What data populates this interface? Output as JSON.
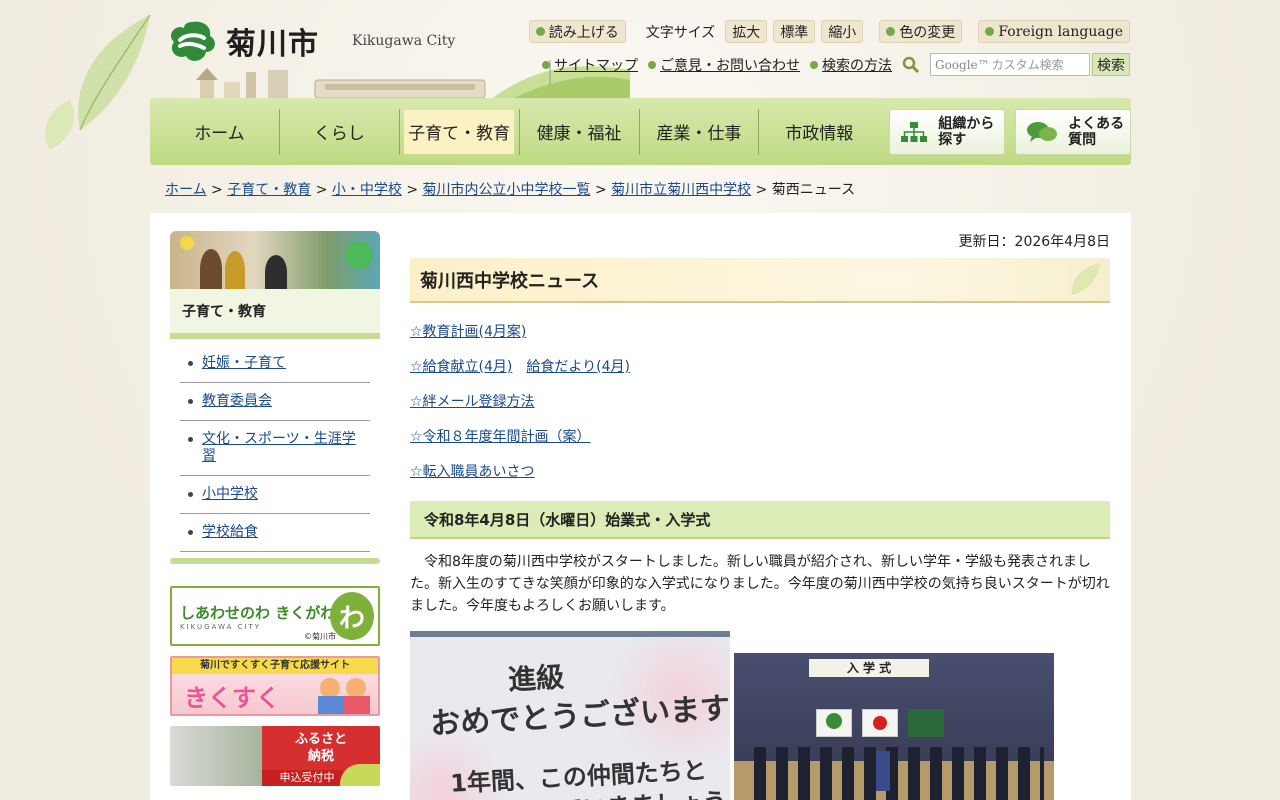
{
  "header": {
    "logo_text": "菊川市",
    "logo_sub": "Kikugawa City",
    "read_aloud": "読み上げる",
    "font_size_label": "文字サイズ",
    "font_enlarge": "拡大",
    "font_standard": "標準",
    "font_shrink": "縮小",
    "color_change": "色の変更",
    "foreign_language": "Foreign language",
    "sitemap": "サイトマップ",
    "contact": "ご意見・お問い合わせ",
    "search_method": "検索の方法",
    "search_placeholder": "カスタム検索",
    "search_google": "Google™",
    "search_button": "検索"
  },
  "nav": {
    "items": [
      "ホーム",
      "くらし",
      "子育て・教育",
      "健康・福祉",
      "産業・仕事",
      "市政情報"
    ],
    "org_button": "組織から\n探す",
    "faq_button": "よくある\n質問"
  },
  "breadcrumb": {
    "items": [
      "ホーム",
      "子育て・教育",
      "小・中学校",
      "菊川市内公立小中学校一覧",
      "菊川市立菊川西中学校"
    ],
    "current": "菊西ニュース"
  },
  "sidebar": {
    "heading": "子育て・教育",
    "items": [
      "妊娠・子育て",
      "教育委員会",
      "文化・スポーツ・生涯学習",
      "小中学校",
      "学校給食"
    ],
    "banner1_text": "しあわせのわ きくがわ",
    "banner1_sub": "KIKUGAWA CITY",
    "banner1_credit": "©菊川市",
    "banner2_top": "菊川ですくすく子育て応援サイト",
    "banner2_main": "きくすく",
    "banner3_line1": "ふるさと",
    "banner3_line2": "納税",
    "banner3_line3": "申込受付中"
  },
  "content": {
    "updated": "更新日：2026年4月8日",
    "title": "菊川西中学校ニュース",
    "links": [
      [
        "☆教育計画(4月案)"
      ],
      [
        "☆給食献立(4月)",
        "給食だより(4月)"
      ],
      [
        "☆絆メール登録方法"
      ],
      [
        "☆令和８年度年間計画（案）"
      ],
      [
        "☆転入職員あいさつ"
      ]
    ],
    "section_title": "令和8年4月8日（水曜日）始業式・入学式",
    "body": "令和8年度の菊川西中学校がスタートしました。新しい職員が紹介され、新しい学年・学級も発表されました。新入生のすてきな笑顔が印象的な入学式になりました。今年度の菊川西中学校の気持ち良いスタートが切れました。今年度もよろしくお願いします。",
    "photo1_line1": "進級",
    "photo1_line2": "おめでとうございます",
    "photo1_line3": "1年間、この仲間たちと",
    "photo1_line4": "一緒に頑張っていきましょう！",
    "photo2_sign": "入 学 式"
  }
}
